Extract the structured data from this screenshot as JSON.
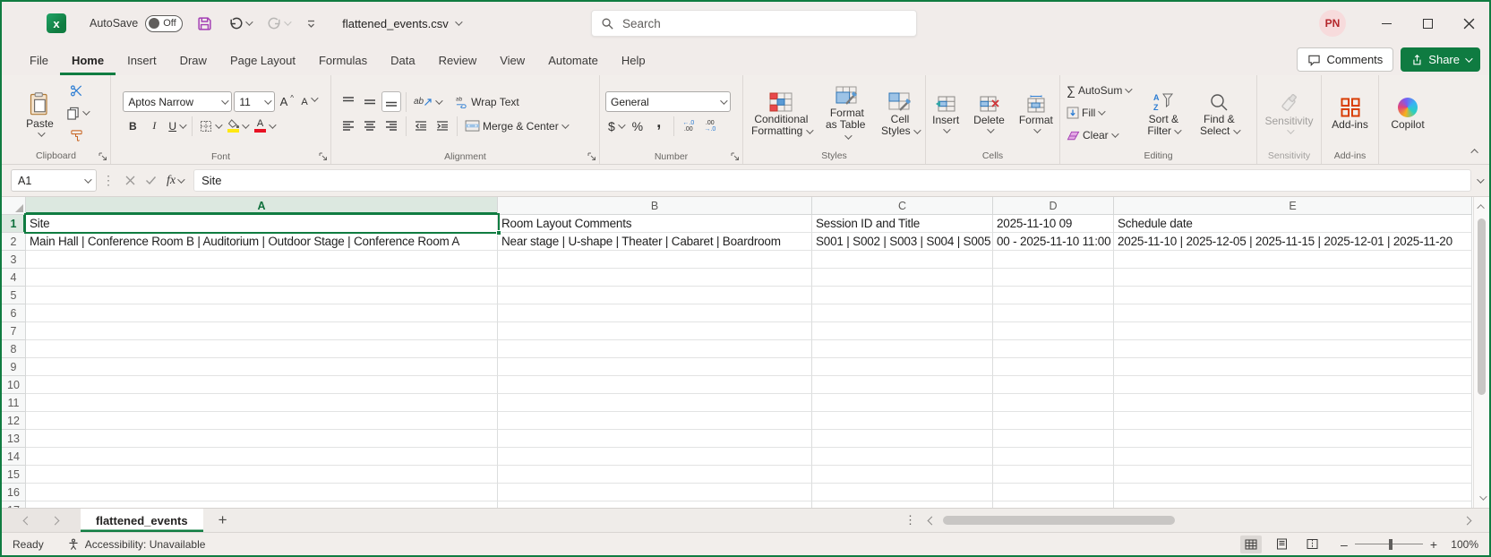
{
  "colors": {
    "accent_green": "#107C41",
    "share_green": "#0F7B41",
    "save_purple": "#A33EB4",
    "fill_yellow": "#FFE812",
    "font_red": "#E81123",
    "addins_orange": "#D83B01",
    "eraser_pink": "#BF3BC0",
    "avatar_bg": "#F7DBDC",
    "avatar_text": "#B4262B"
  },
  "titlebar": {
    "autosave_label": "AutoSave",
    "autosave_state": "Off",
    "filename": "flattened_events.csv",
    "search_placeholder": "Search",
    "user_initials": "PN"
  },
  "ribbon_tabs": [
    "File",
    "Home",
    "Insert",
    "Draw",
    "Page Layout",
    "Formulas",
    "Data",
    "Review",
    "View",
    "Automate",
    "Help"
  ],
  "active_tab": "Home",
  "tab_actions": {
    "comments": "Comments",
    "share": "Share"
  },
  "ribbon": {
    "clipboard": {
      "paste": "Paste",
      "group_label": "Clipboard"
    },
    "font": {
      "font_name": "Aptos Narrow",
      "font_size": "11",
      "bold": "B",
      "italic": "I",
      "underline": "U",
      "group_label": "Font"
    },
    "alignment": {
      "wrap_text": "Wrap Text",
      "merge_center": "Merge & Center",
      "group_label": "Alignment"
    },
    "number": {
      "format": "General",
      "currency": "$",
      "percent": "%",
      "comma": ",",
      "group_label": "Number"
    },
    "styles": {
      "conditional": "Conditional Formatting",
      "format_table": "Format as Table",
      "cell_styles": "Cell Styles",
      "group_label": "Styles"
    },
    "cells": {
      "insert": "Insert",
      "delete": "Delete",
      "format": "Format",
      "group_label": "Cells"
    },
    "editing": {
      "autosum": "AutoSum",
      "fill": "Fill",
      "clear": "Clear",
      "sort_filter": "Sort & Filter",
      "find_select": "Find & Select",
      "group_label": "Editing"
    },
    "sensitivity": {
      "label": "Sensitivity",
      "group_label": "Sensitivity"
    },
    "addins": {
      "label": "Add-ins",
      "group_label": "Add-ins"
    },
    "copilot": {
      "label": "Copilot"
    }
  },
  "formula_bar": {
    "name_box": "A1",
    "function_label": "fx",
    "content": "Site"
  },
  "sheet": {
    "columns": [
      "A",
      "B",
      "C",
      "D",
      "E"
    ],
    "active_cell": "A1",
    "rows": [
      {
        "n": 1,
        "cells": [
          "Site",
          "Room Layout Comments",
          "Session ID and Title",
          "2025-11-10 09",
          "Schedule date"
        ]
      },
      {
        "n": 2,
        "cells": [
          "Main Hall | Conference Room B | Auditorium | Outdoor Stage | Conference Room A",
          "Near stage | U-shape | Theater | Cabaret | Boardroom",
          "S001 | S002 | S003 | S004 | S005",
          "00 - 2025-11-10 11:00",
          "2025-11-10 | 2025-12-05 | 2025-11-15 | 2025-12-01 | 2025-11-20"
        ]
      }
    ],
    "visible_row_count": 17
  },
  "sheet_tabs": {
    "active": "flattened_events"
  },
  "status_bar": {
    "ready": "Ready",
    "accessibility": "Accessibility: Unavailable",
    "zoom_level": "100%"
  }
}
